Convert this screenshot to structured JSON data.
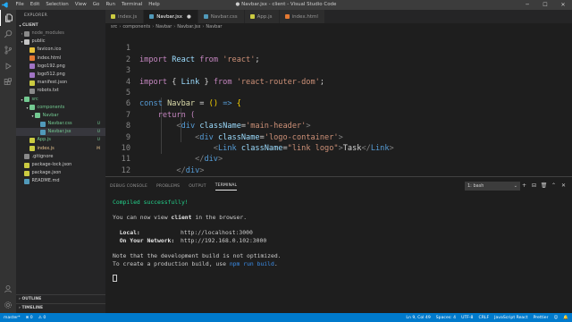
{
  "window": {
    "title": "● Navbar.jsx - client - Visual Studio Code",
    "menu": [
      "File",
      "Edit",
      "Selection",
      "View",
      "Go",
      "Run",
      "Terminal",
      "Help"
    ],
    "controls": [
      "─",
      "☐",
      "✕"
    ]
  },
  "sidebar": {
    "header": "EXPLORER",
    "folder": "CLIENT",
    "tree": [
      {
        "name": "node_modules",
        "kind": "folder",
        "depth": 0,
        "open": false,
        "color": "#8a8a8a",
        "dim": true
      },
      {
        "name": "public",
        "kind": "folder",
        "depth": 0,
        "open": true,
        "color": "#c5c5c5"
      },
      {
        "name": "favicon.ico",
        "kind": "file",
        "depth": 1,
        "color": "#e8c23a"
      },
      {
        "name": "index.html",
        "kind": "file",
        "depth": 1,
        "color": "#e37933"
      },
      {
        "name": "logo192.png",
        "kind": "file",
        "depth": 1,
        "color": "#a074c4"
      },
      {
        "name": "logo512.png",
        "kind": "file",
        "depth": 1,
        "color": "#a074c4"
      },
      {
        "name": "manifest.json",
        "kind": "file",
        "depth": 1,
        "color": "#cbcb41"
      },
      {
        "name": "robots.txt",
        "kind": "file",
        "depth": 1,
        "color": "#8a8a8a"
      },
      {
        "name": "src",
        "kind": "folder",
        "depth": 0,
        "open": true,
        "color": "#73c991"
      },
      {
        "name": "components",
        "kind": "folder",
        "depth": 1,
        "open": true,
        "color": "#73c991"
      },
      {
        "name": "Navbar",
        "kind": "folder",
        "depth": 2,
        "open": true,
        "color": "#73c991"
      },
      {
        "name": "Navbar.css",
        "kind": "file",
        "depth": 3,
        "color": "#519aba",
        "badge": "U"
      },
      {
        "name": "Navbar.jsx",
        "kind": "file",
        "depth": 3,
        "color": "#519aba",
        "badge": "U",
        "selected": true
      },
      {
        "name": "App.js",
        "kind": "file",
        "depth": 1,
        "color": "#cbcb41",
        "badge": "U"
      },
      {
        "name": "index.js",
        "kind": "file",
        "depth": 1,
        "color": "#cbcb41",
        "badge": "M"
      },
      {
        "name": ".gitignore",
        "kind": "file",
        "depth": 0,
        "color": "#8a8a8a"
      },
      {
        "name": "package-lock.json",
        "kind": "file",
        "depth": 0,
        "color": "#cbcb41"
      },
      {
        "name": "package.json",
        "kind": "file",
        "depth": 0,
        "color": "#cbcb41"
      },
      {
        "name": "README.md",
        "kind": "file",
        "depth": 0,
        "color": "#519aba"
      }
    ],
    "outline": "OUTLINE",
    "timeline": "TIMELINE"
  },
  "tabs": [
    {
      "label": "index.js",
      "color": "#cbcb41",
      "active": false
    },
    {
      "label": "Navbar.jsx",
      "color": "#519aba",
      "active": true
    },
    {
      "label": "Navbar.css",
      "color": "#519aba",
      "active": false
    },
    {
      "label": "App.js",
      "color": "#cbcb41",
      "active": false
    },
    {
      "label": "index.html",
      "color": "#e37933",
      "active": false
    }
  ],
  "breadcrumb": [
    "src",
    "components",
    "Navbar",
    "Navbar.jsx",
    "Navbar"
  ],
  "editor": {
    "line_numbers": [
      "1",
      "2",
      "3",
      "4",
      "5",
      "6",
      "7",
      "8",
      "9",
      "10",
      "11",
      "12"
    ]
  },
  "panel": {
    "tabs": [
      "DEBUG CONSOLE",
      "PROBLEMS",
      "OUTPUT",
      "TERMINAL"
    ],
    "active_tab": "TERMINAL",
    "terminal_select": "1: bash",
    "actions": [
      "+",
      "⊟",
      "🗑",
      "⌃",
      "✕"
    ],
    "output": {
      "compiled": "Compiled successfully!",
      "view_prefix": "You can now view ",
      "app_name": "client",
      "view_suffix": " in the browser.",
      "local_label": "  Local:",
      "local_url": "http://localhost:3000",
      "network_label": "  On Your Network:",
      "network_url": "http://192.168.0.102:3000",
      "note1": "Note that the development build is not optimized.",
      "note2_prefix": "To create a production build, use ",
      "note2_cmd": "npm run build",
      "note2_suffix": "."
    }
  },
  "status": {
    "branch": "master*",
    "errors": "⊗ 0",
    "warnings": "⚠ 0",
    "position": "Ln 9, Col 49",
    "spaces": "Spaces: 4",
    "encoding": "UTF-8",
    "eol": "CRLF",
    "language": "JavaScript React",
    "formatter": "Prettier",
    "bell": "🔔",
    "feedback": "☺"
  }
}
